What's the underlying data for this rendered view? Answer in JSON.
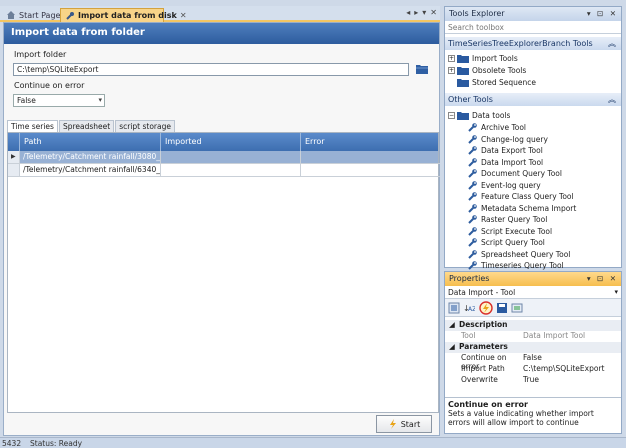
{
  "doc_tabs": {
    "start_page": "Start Page",
    "import_tab": "Import data from disk",
    "controls": [
      "◂",
      "▸",
      "▾",
      "✕"
    ]
  },
  "doc": {
    "header": "Import data from folder",
    "folder_label": "Import folder",
    "folder_value": "C:\\temp\\SQLiteExport",
    "error_label": "Continue on error",
    "error_value": "False",
    "tabs": [
      "Time series",
      "Spreadsheet",
      "script storage"
    ],
    "columns": [
      "Path",
      "Imported",
      "Error"
    ],
    "rows": [
      {
        "path": "/Telemetry/Catchment rainfall/3080_...",
        "imported": "",
        "error": ""
      },
      {
        "path": "/Telemetry/Catchment rainfall/6340_...",
        "imported": "",
        "error": ""
      }
    ],
    "start_label": "Start"
  },
  "status": {
    "left": "5432",
    "text": "Status: Ready"
  },
  "toolbox": {
    "title": "Tools Explorer",
    "controls": "▾ ⊡ ✕",
    "search_placeholder": "Search toolbox",
    "section1": "TimeSeriesTreeExplorerBranch Tools",
    "section1_items": [
      {
        "label": "Import Tools",
        "expander": "+"
      },
      {
        "label": "Obsolete Tools",
        "expander": "+"
      },
      {
        "label": "Stored Sequence",
        "expander": ""
      }
    ],
    "section2": "Other Tools",
    "folder": "Data tools",
    "tools": [
      "Archive Tool",
      "Change-log query",
      "Data Export Tool",
      "Data Import Tool",
      "Document Query Tool",
      "Event-log query",
      "Feature Class Query Tool",
      "Metadata Schema Import",
      "Raster Query Tool",
      "Script Execute Tool",
      "Script Query Tool",
      "Spreadsheet Query Tool",
      "Timeseries Query Tool"
    ]
  },
  "properties": {
    "title": "Properties",
    "controls": "▾ ⊡ ✕",
    "object": "Data Import - Tool",
    "categories": [
      {
        "name": "Description",
        "rows": [
          {
            "key": "Tool",
            "value": "Data Import Tool",
            "dim": true
          }
        ]
      },
      {
        "name": "Parameters",
        "rows": [
          {
            "key": "Continue on error",
            "value": "False",
            "dim": false
          },
          {
            "key": "Import Path",
            "value": "C:\\temp\\SQLiteExport",
            "dim": false
          },
          {
            "key": "Overwrite",
            "value": "True",
            "dim": false
          }
        ]
      }
    ],
    "desc_title": "Continue on error",
    "desc_text": "Sets a value indicating whether import errors will allow import to continue"
  },
  "colors": {
    "header_blue": "#2d5c9e",
    "tab_orange": "#f8d488",
    "selection": "#98b1d4"
  }
}
